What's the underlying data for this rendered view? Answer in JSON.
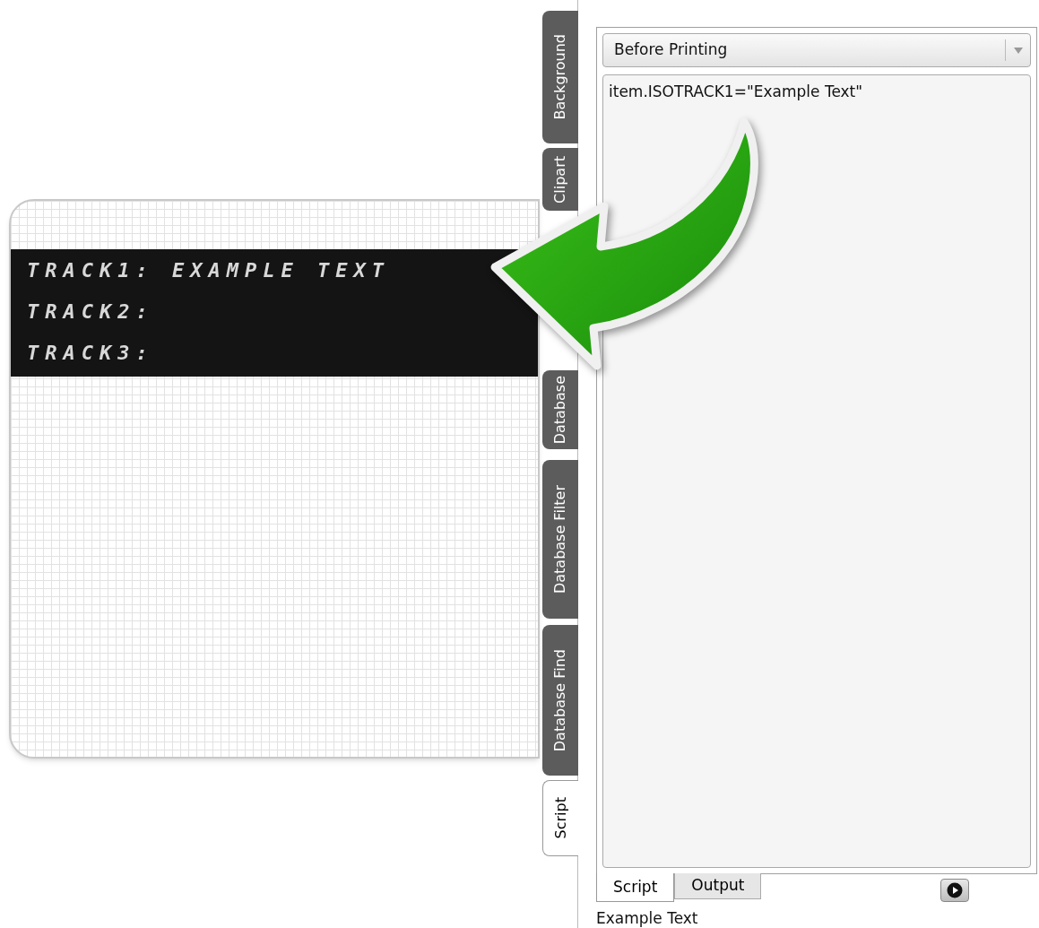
{
  "card": {
    "stripe_lines": [
      "TRACK1: EXAMPLE TEXT",
      "TRACK2:",
      "TRACK3:"
    ]
  },
  "side_tabs": [
    {
      "label": "Background",
      "selected": false
    },
    {
      "label": "Clipart",
      "selected": false
    },
    {
      "label": "Database",
      "selected": false
    },
    {
      "label": "Database Filter",
      "selected": false
    },
    {
      "label": "Database Find",
      "selected": false
    },
    {
      "label": "Script",
      "selected": true
    }
  ],
  "script_panel": {
    "event_dropdown": "Before Printing",
    "code": "item.ISOTRACK1=\"Example Text\"",
    "bottom_tabs": [
      {
        "label": "Script",
        "selected": true
      },
      {
        "label": "Output",
        "selected": false
      }
    ]
  },
  "output_text": "Example Text"
}
